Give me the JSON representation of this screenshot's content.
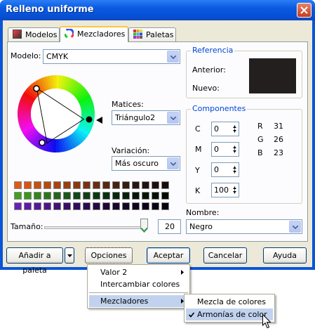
{
  "window": {
    "title": "Relleno uniforme"
  },
  "tabs": [
    {
      "label": "Modelos",
      "icon": "color-square-icon"
    },
    {
      "label": "Mezcladores",
      "icon": "color-wheel-icon",
      "active": true
    },
    {
      "label": "Paletas",
      "icon": "palette-grid-icon"
    }
  ],
  "model": {
    "label": "Modelo:",
    "value": "CMYK"
  },
  "hues": {
    "label": "Matices:",
    "value": "Triángulo2"
  },
  "variation": {
    "label": "Variación:",
    "value": "Más oscuro"
  },
  "reference": {
    "title": "Referencia",
    "previous_label": "Anterior:",
    "new_label": "Nuevo:",
    "color": "#231f1e"
  },
  "components": {
    "title": "Componentes",
    "c_label": "C",
    "c_value": "0",
    "m_label": "M",
    "m_value": "0",
    "y_label": "Y",
    "y_value": "0",
    "k_label": "K",
    "k_value": "100",
    "r_label": "R",
    "r_value": "31",
    "g_label": "G",
    "g_value": "26",
    "b_label": "B",
    "b_value": "23"
  },
  "size": {
    "label": "Tamaño:",
    "value": "20",
    "level_fraction": 0.95
  },
  "name": {
    "label": "Nombre:",
    "value": "Negro"
  },
  "buttons": {
    "add_palette": "Añadir a paleta",
    "options": "Opciones",
    "accept": "Aceptar",
    "cancel": "Cancelar",
    "help": "Ayuda"
  },
  "options_menu": {
    "items": [
      {
        "label": "Valor 2",
        "submenu": true
      },
      {
        "label": "Intercambiar colores",
        "submenu": false
      },
      {
        "label": "Mezcladores",
        "submenu": true,
        "highlighted": true
      }
    ]
  },
  "mixers_submenu": {
    "items": [
      {
        "label": "Mezcla de colores",
        "checked": false
      },
      {
        "label": "Armonías de color",
        "checked": true,
        "highlighted": true
      }
    ]
  },
  "swatches": {
    "rows": [
      [
        "#e05a10",
        "#d85510",
        "#c85010",
        "#b84a10",
        "#a84410",
        "#983e10",
        "#883810",
        "#783210",
        "#682c10",
        "#582610",
        "#482010",
        "#381a10",
        "#281410",
        "#201010",
        "#1c0e0e",
        "#180c0c"
      ],
      [
        "#40a020",
        "#389818",
        "#308818",
        "#287818",
        "#206818",
        "#185818",
        "#104818",
        "#0c4014",
        "#083810",
        "#06300e",
        "#05280c",
        "#04200a",
        "#031808",
        "#021406",
        "#021004",
        "#010c03"
      ],
      [
        "#6a20b8",
        "#6018a8",
        "#561898",
        "#4c1488",
        "#421078",
        "#380c68",
        "#300c5c",
        "#2a0a50",
        "#240844",
        "#1e0638",
        "#18052e",
        "#140426",
        "#10031e",
        "#0c0218",
        "#0a0214",
        "#080210"
      ]
    ]
  },
  "colors": {
    "title_bar": "#0a5ae0",
    "dialog_bg": "#ece9d8",
    "group_title": "#0046d5",
    "menu_highlight": "#c1d2ee"
  }
}
